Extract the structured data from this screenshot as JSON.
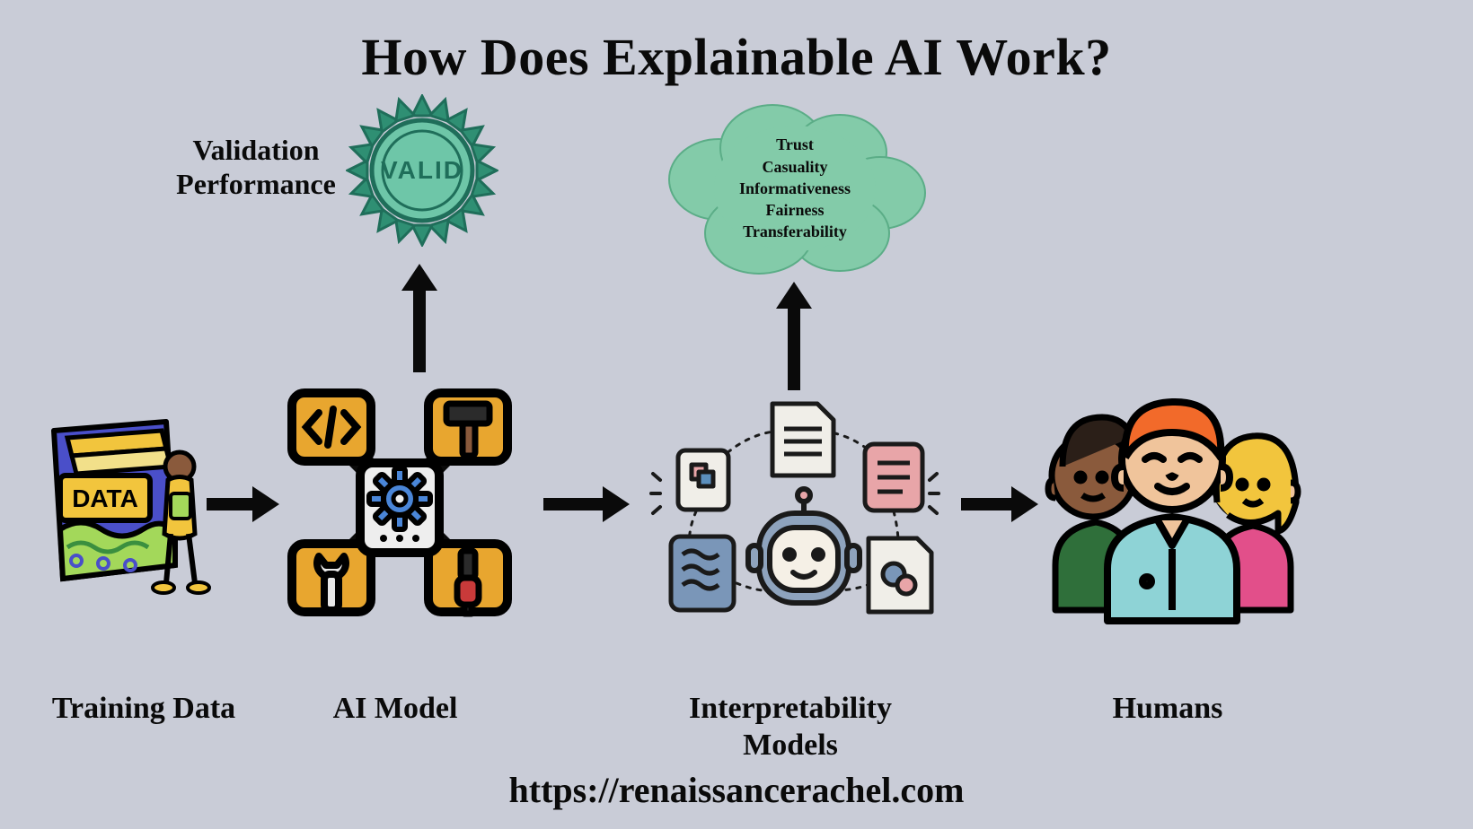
{
  "title": "How Does Explainable AI Work?",
  "footer_url": "https://renaissancerachel.com",
  "validation": {
    "label": "Validation\nPerformance",
    "badge_text": "VALID"
  },
  "cloud": {
    "items": [
      "Trust",
      "Casuality",
      "Informativeness",
      "Fairness",
      "Transferability"
    ]
  },
  "nodes": {
    "training_data": {
      "label": "Training Data",
      "book_text": "DATA"
    },
    "ai_model": {
      "label": "AI Model"
    },
    "interpretability": {
      "label": "Interpretability\nModels"
    },
    "humans": {
      "label": "Humans"
    }
  },
  "colors": {
    "bg": "#c9ccd7",
    "ink": "#0a0a0a",
    "teal": "#6ec6a8",
    "teal_dark": "#1f6e5a",
    "amber": "#e8a62f",
    "orange": "#f07f2f",
    "blue": "#5b8fbd",
    "pink": "#e8a5a8",
    "skin1": "#8a5a3c",
    "skin2": "#f0c49b",
    "skin3": "#f0c49b",
    "hair_orange": "#f26a2a",
    "hair_yellow": "#f2c53d",
    "shirt_teal": "#8ed3d6",
    "shirt_pink": "#e24f8a",
    "gear_blue": "#4a86d8",
    "book_green": "#a3d85a",
    "book_blue": "#4a4fc9",
    "book_yellow": "#f2c53d"
  }
}
